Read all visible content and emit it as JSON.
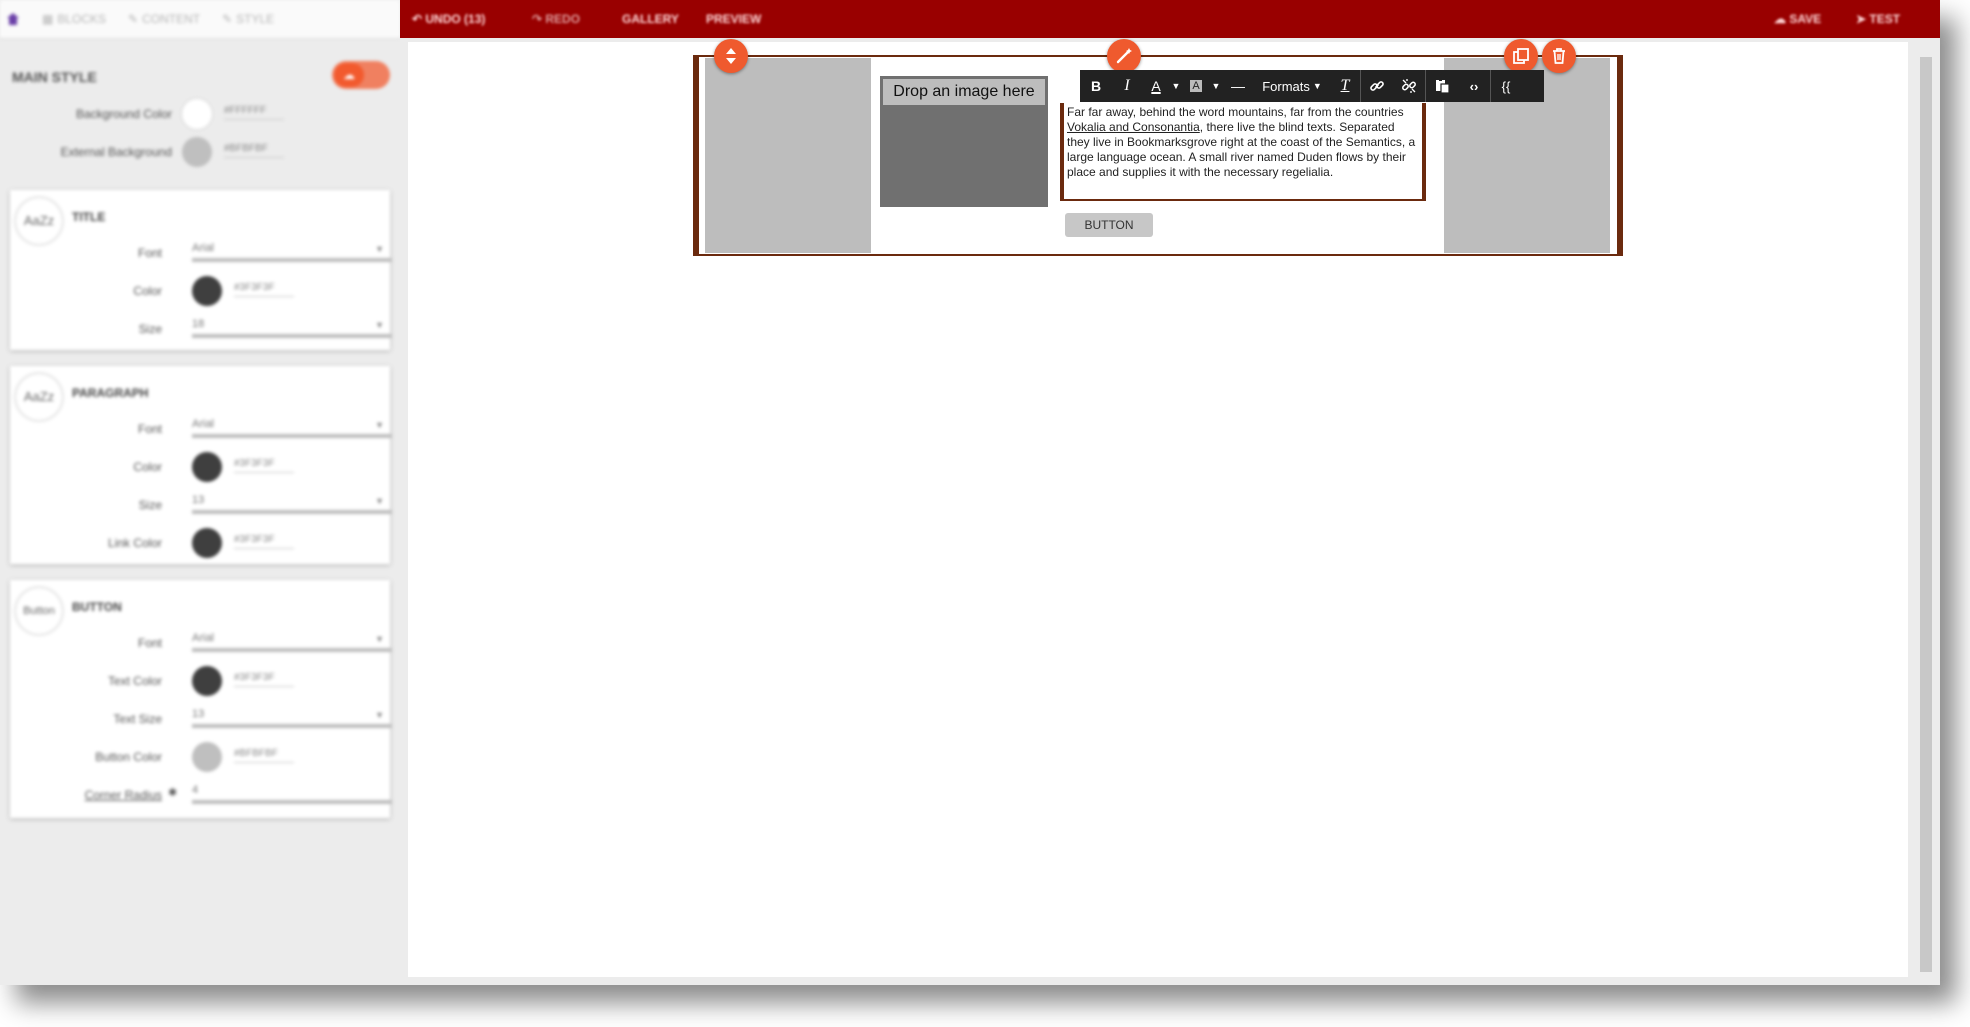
{
  "left_panel": {
    "tabs": [
      {
        "label": "BLOCKS",
        "icon": "blocks-icon"
      },
      {
        "label": "CONTENT",
        "icon": "pencil-icon"
      },
      {
        "label": "STYLE",
        "icon": "brush-icon"
      }
    ],
    "main_style": {
      "title": "MAIN STYLE",
      "background_color": {
        "label": "Background Color",
        "value": "#FFFFFF"
      },
      "external_background": {
        "label": "External Background",
        "value": "#BFBFBF"
      }
    },
    "title_card": {
      "badge": "AaZz",
      "title": "TITLE",
      "font": {
        "label": "Font",
        "value": "Arial"
      },
      "color": {
        "label": "Color",
        "value": "#3F3F3F"
      },
      "size": {
        "label": "Size",
        "value": "18"
      }
    },
    "paragraph_card": {
      "badge": "AaZz",
      "title": "PARAGRAPH",
      "font": {
        "label": "Font",
        "value": "Arial"
      },
      "color": {
        "label": "Color",
        "value": "#3F3F3F"
      },
      "size": {
        "label": "Size",
        "value": "13"
      },
      "link_color": {
        "label": "Link Color",
        "value": "#3F3F3F"
      }
    },
    "button_card": {
      "badge": "Button",
      "title": "BUTTON",
      "font": {
        "label": "Font",
        "value": "Arial"
      },
      "text_color": {
        "label": "Text Color",
        "value": "#3F3F3F"
      },
      "text_size": {
        "label": "Text Size",
        "value": "13"
      },
      "button_color": {
        "label": "Button Color",
        "value": "#BFBFBF"
      },
      "corner_radius": {
        "label": "Corner Radius",
        "value": "4"
      }
    }
  },
  "topbar": {
    "undo": "UNDO (13)",
    "redo": "REDO",
    "gallery": "GALLERY",
    "preview": "PREVIEW",
    "save": "SAVE",
    "test": "TEST"
  },
  "editor": {
    "image_placeholder": "Drop an image here",
    "paragraph": {
      "before": "Far far away, behind the word mountains, far from the countries ",
      "link": "Vokalia and Consonantia",
      "after": ", there live the blind texts. Separated they live in Bookmarksgrove right at the coast of the Semantics, a large language ocean. A small river named Duden flows by their place and supplies it with the necessary regelialia."
    },
    "button_label": "BUTTON",
    "toolbar": {
      "bold": "B",
      "italic": "I",
      "text_color": "A",
      "bg_color": "A",
      "hr": "—",
      "formats": "Formats",
      "clear": "T",
      "merge_tags": "{{"
    }
  },
  "colors": {
    "accent": "#EF5A2E",
    "topbar": "#990000",
    "block_border": "#6B2A0E",
    "swatch_dark": "#3F3F3F",
    "swatch_light": "#BFBFBF",
    "swatch_white": "#FFFFFF"
  }
}
